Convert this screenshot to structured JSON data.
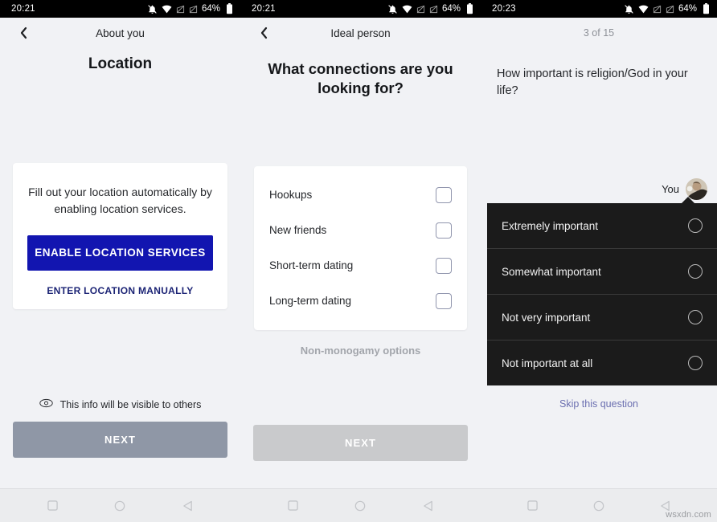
{
  "panels": [
    {
      "status": {
        "time": "20:21",
        "battery": "64%",
        "icons": [
          "bell-muted-icon",
          "wifi-icon",
          "signal-off-icon",
          "signal-off-icon",
          "battery-icon"
        ]
      },
      "header": {
        "back": "chevron-left-icon",
        "nav_title": "About you"
      },
      "page_title": "Location",
      "card": {
        "body": "Fill out your location automatically by enabling location services.",
        "primary_button": "ENABLE LOCATION SERVICES",
        "secondary_link": "ENTER LOCATION MANUALLY"
      },
      "visibility": {
        "icon": "eye-icon",
        "text": "This info will be visible to others"
      },
      "next_label": "NEXT"
    },
    {
      "status": {
        "time": "20:21",
        "battery": "64%"
      },
      "header": {
        "back": "chevron-left-icon",
        "nav_title": "Ideal person"
      },
      "page_title": "What connections are you looking for?",
      "options": [
        {
          "label": "Hookups",
          "checked": false
        },
        {
          "label": "New friends",
          "checked": false
        },
        {
          "label": "Short-term dating",
          "checked": false
        },
        {
          "label": "Long-term dating",
          "checked": false
        }
      ],
      "footer_link": "Non-monogamy options",
      "next_label": "NEXT"
    },
    {
      "status": {
        "time": "20:23",
        "battery": "64%"
      },
      "step_counter": "3 of 15",
      "question": "How important is religion/God in your life?",
      "you_label": "You",
      "answers": [
        {
          "label": "Extremely important",
          "selected": false
        },
        {
          "label": "Somewhat important",
          "selected": false
        },
        {
          "label": "Not very important",
          "selected": false
        },
        {
          "label": "Not important at all",
          "selected": false
        }
      ],
      "skip_link": "Skip this question"
    }
  ],
  "navbar": {
    "recents": "square-icon",
    "home": "circle-icon",
    "back": "triangle-back-icon"
  },
  "watermark": "wsxdn.com",
  "colors": {
    "background": "#f1f2f5",
    "primary_blue": "#1215b0",
    "link_blue": "#1c2475",
    "skip_blue": "#6b6fb0",
    "next_dark": "#8f97a6",
    "next_light": "#c9cacc",
    "dark_panel": "#1b1b1b",
    "statusbar": "#000000"
  }
}
